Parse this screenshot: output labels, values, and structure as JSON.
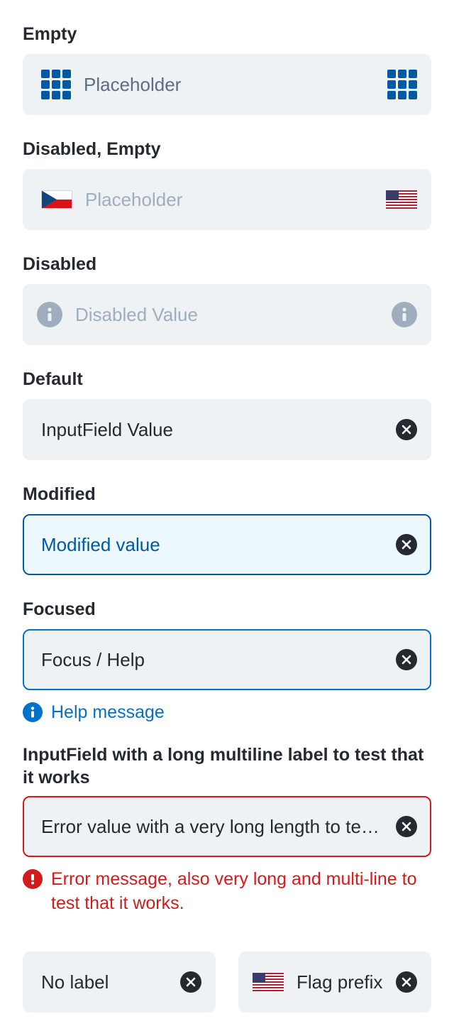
{
  "fields": [
    {
      "label": "Empty",
      "placeholder": "Placeholder",
      "prefix_icon": "grid-icon",
      "suffix_icon": "grid-icon"
    },
    {
      "label": "Disabled, Empty",
      "placeholder": "Placeholder",
      "prefix_icon": "czech-flag-icon",
      "suffix_icon": "us-flag-icon"
    },
    {
      "label": "Disabled",
      "value": "Disabled Value",
      "prefix_icon": "info-icon",
      "suffix_icon": "info-icon"
    },
    {
      "label": "Default",
      "value": "InputField Value",
      "suffix_icon": "clear-icon"
    },
    {
      "label": "Modified",
      "value": "Modified value",
      "suffix_icon": "clear-icon"
    },
    {
      "label": "Focused",
      "value": "Focus / Help",
      "suffix_icon": "clear-icon",
      "help": "Help message"
    },
    {
      "label": "InputField with a long multiline label to test that it works",
      "value": "Error value with a very long length to test that it works",
      "suffix_icon": "clear-icon",
      "error": "Error message, also very long and multi-line to test that it works."
    }
  ],
  "bottom_row": [
    {
      "value": "No label",
      "suffix_icon": "clear-icon"
    },
    {
      "value": "Flag prefix",
      "prefix_icon": "us-flag-icon",
      "suffix_icon": "clear-icon"
    }
  ],
  "colors": {
    "primary": "#005aa3",
    "focus": "#0172cb",
    "error": "#d21c1c",
    "field_bg": "#eff2f5",
    "modified_bg": "#edf7fe",
    "disabled_text": "#9fadbf",
    "ink": "#252a31"
  }
}
